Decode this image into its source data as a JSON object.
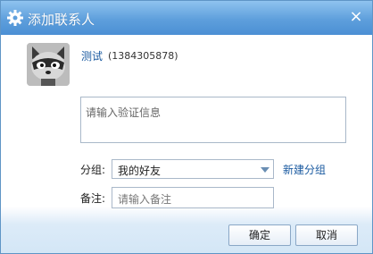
{
  "window": {
    "title": "添加联系人",
    "close_glyph": "×",
    "title_icon": "gear-icon"
  },
  "contact": {
    "name": "测试",
    "id": "(1384305878)",
    "avatar": "raccoon-avatar"
  },
  "form": {
    "verify_placeholder": "请输入验证信息",
    "group_label": "分组:",
    "group_value": "我的好友",
    "new_group_label": "新建分组",
    "remark_label": "备注:",
    "remark_placeholder": "请输入备注"
  },
  "buttons": {
    "ok_label": "确定",
    "cancel_label": "取消"
  },
  "colors": {
    "titlebar": "#5e9fdc",
    "link": "#1a5aa0"
  }
}
